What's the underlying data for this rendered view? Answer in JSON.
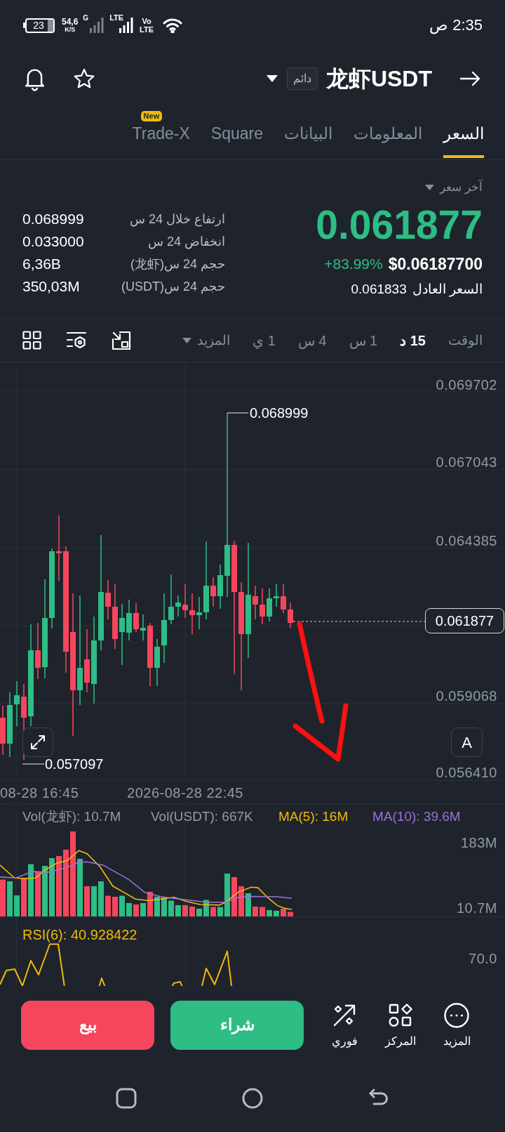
{
  "status_bar": {
    "battery": "23",
    "net_speed": "54,6",
    "net_speed_unit": "K/S",
    "network_type": "G",
    "network_type_2": "LTE",
    "volte": [
      "Vo",
      "LTE"
    ],
    "time": "2:35 ص"
  },
  "header": {
    "title": "龙虾USDT",
    "badge": "دائم"
  },
  "tabs": [
    {
      "label": "السعر",
      "selected": true
    },
    {
      "label": "المعلومات",
      "selected": false
    },
    {
      "label": "البيانات",
      "selected": false
    },
    {
      "label": "Square",
      "selected": false
    },
    {
      "label": "Trade-X",
      "selected": false,
      "badge": "New"
    }
  ],
  "ticker": {
    "last_price_label": "آخر سعر",
    "last_price": "0.061877",
    "price_usd": "$0.06187700",
    "change": "+83.99%",
    "fair_price_label": "السعر العادل",
    "fair_price": "0.061833",
    "stats": [
      {
        "label": "ارتفاع خلال 24 س",
        "value": "0.068999"
      },
      {
        "label": "انخفاض 24 س",
        "value": "0.033000"
      },
      {
        "label": "حجم 24 س(龙虾)",
        "value": "6,36B"
      },
      {
        "label": "حجم 24 س(USDT)",
        "value": "350,03M"
      }
    ]
  },
  "chart_toolbar": {
    "time_label": "الوقت",
    "intervals": [
      {
        "label": "15 د",
        "selected": true
      },
      {
        "label": "1 س",
        "selected": false
      },
      {
        "label": "4 س",
        "selected": false
      },
      {
        "label": "1 ي",
        "selected": false
      }
    ],
    "more": "المزيد"
  },
  "price_chart": {
    "price_axis": [
      "0.069702",
      "0.067043",
      "0.064385",
      "0.059068",
      "0.056410"
    ],
    "current_price": "0.061877",
    "high_marker": "0.068999",
    "low_marker": "0.057097",
    "auto_button": "A",
    "time_axis": [
      "2026-08-28 22:45",
      "08-28 16:45"
    ]
  },
  "volume": {
    "legend": [
      {
        "text": "MA(10): 39.6M",
        "color": "#9a72d8"
      },
      {
        "text": "MA(5): 16M",
        "color": "#f0b90b"
      },
      {
        "text": "Vol(USDT): 667K",
        "color": "#929aa5"
      },
      {
        "text": "Vol(龙虾): 10.7M",
        "color": "#929aa5"
      }
    ],
    "axis": [
      "183M",
      "10.7M"
    ]
  },
  "rsi": {
    "legend": "RSI(6): 40.928422",
    "axis": [
      "70.0"
    ]
  },
  "actions": [
    {
      "label": "المزيد"
    },
    {
      "label": "المركز"
    },
    {
      "label": "فوري"
    }
  ],
  "trade_buttons": {
    "buy": "شراء",
    "sell": "بيع"
  }
}
